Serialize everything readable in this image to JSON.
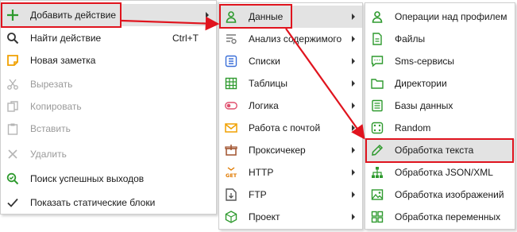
{
  "menu1": {
    "items": [
      {
        "label": "Добавить действие",
        "icon": "plus-icon",
        "submenu": true,
        "disabled": false
      },
      {
        "label": "Найти действие",
        "icon": "search-icon",
        "shortcut": "Ctrl+T",
        "disabled": false
      },
      {
        "label": "Новая заметка",
        "icon": "note-icon",
        "disabled": false
      },
      {
        "label": "Вырезать",
        "icon": "scissors-icon",
        "disabled": true
      },
      {
        "label": "Копировать",
        "icon": "copy-icon",
        "disabled": true
      },
      {
        "label": "Вставить",
        "icon": "paste-icon",
        "disabled": true
      },
      {
        "label": "Удалить",
        "icon": "delete-icon",
        "disabled": true
      },
      {
        "label": "Поиск успешных выходов",
        "icon": "search-success-icon",
        "disabled": false
      },
      {
        "label": "Показать статические блоки",
        "icon": "checkmark-icon",
        "disabled": false
      }
    ]
  },
  "menu2": {
    "items": [
      {
        "label": "Данные",
        "icon": "user-icon"
      },
      {
        "label": "Анализ содержимого",
        "icon": "analysis-icon"
      },
      {
        "label": "Списки",
        "icon": "list-icon"
      },
      {
        "label": "Таблицы",
        "icon": "table-icon"
      },
      {
        "label": "Логика",
        "icon": "toggle-icon"
      },
      {
        "label": "Работа с почтой",
        "icon": "mail-icon"
      },
      {
        "label": "Проксичекер",
        "icon": "box-icon"
      },
      {
        "label": "HTTP",
        "icon": "get-icon"
      },
      {
        "label": "FTP",
        "icon": "ftp-icon"
      },
      {
        "label": "Проект",
        "icon": "cube-icon"
      }
    ]
  },
  "menu3": {
    "items": [
      {
        "label": "Операции над профилем",
        "icon": "profile-icon"
      },
      {
        "label": "Файлы",
        "icon": "file-icon"
      },
      {
        "label": "Sms-сервисы",
        "icon": "sms-icon"
      },
      {
        "label": "Директории",
        "icon": "folder-icon"
      },
      {
        "label": "Базы данных",
        "icon": "database-icon"
      },
      {
        "label": "Random",
        "icon": "dice-icon"
      },
      {
        "label": "Обработка текста",
        "icon": "pencil-icon"
      },
      {
        "label": "Обработка JSON/XML",
        "icon": "tree-icon"
      },
      {
        "label": "Обработка изображений",
        "icon": "image-icon"
      },
      {
        "label": "Обработка переменных",
        "icon": "grid-icon"
      }
    ]
  },
  "colors": {
    "accent_red": "#e0141e",
    "green": "#2e9a2e",
    "highlight": "#e3e3e3"
  }
}
